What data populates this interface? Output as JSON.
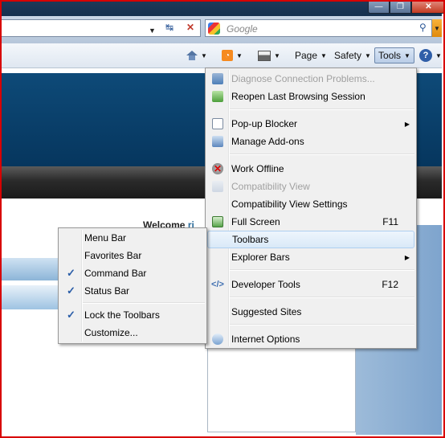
{
  "search": {
    "placeholder": "Google"
  },
  "window_buttons": {
    "minimize": "—",
    "maximize": "❐",
    "close": "✕"
  },
  "command_bar": {
    "page_label": "Page",
    "safety_label": "Safety",
    "tools_label": "Tools"
  },
  "page": {
    "welcome_text": "Welcome",
    "welcome_name": "ri"
  },
  "tools_menu": {
    "items": [
      {
        "label": "Diagnose Connection Problems...",
        "disabled": true
      },
      {
        "label": "Reopen Last Browsing Session"
      },
      {
        "label": "Pop-up Blocker",
        "submenu": true
      },
      {
        "label": "Manage Add-ons"
      },
      {
        "label": "Work Offline"
      },
      {
        "label": "Compatibility View",
        "disabled": true
      },
      {
        "label": "Compatibility View Settings"
      },
      {
        "label": "Full Screen",
        "shortcut": "F11"
      },
      {
        "label": "Toolbars",
        "submenu": true,
        "highlighted": true
      },
      {
        "label": "Explorer Bars",
        "submenu": true
      },
      {
        "label": "Developer Tools",
        "shortcut": "F12"
      },
      {
        "label": "Suggested Sites"
      },
      {
        "label": "Internet Options"
      }
    ]
  },
  "toolbars_submenu": {
    "items": [
      {
        "label": "Menu Bar",
        "checked": false
      },
      {
        "label": "Favorites Bar",
        "checked": false
      },
      {
        "label": "Command Bar",
        "checked": true
      },
      {
        "label": "Status Bar",
        "checked": true
      },
      {
        "label": "Lock the Toolbars",
        "checked": true
      },
      {
        "label": "Customize...",
        "checked": false
      }
    ]
  },
  "colors": {
    "frame_border": "#d80000",
    "banner": "#0e4a78",
    "accent": "#2f5ea8"
  }
}
